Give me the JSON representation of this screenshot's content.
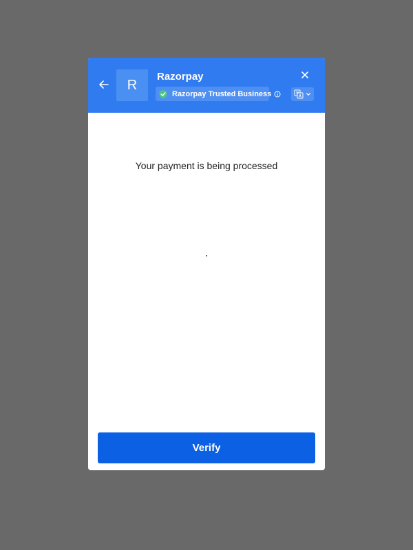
{
  "header": {
    "logo_letter": "R",
    "merchant_name": "Razorpay",
    "trust_badge": "Razorpay Trusted Business",
    "icons": {
      "back": "arrow-left-icon",
      "close": "close-icon",
      "shield": "shield-check-icon",
      "info": "info-icon",
      "language": "translate-icon",
      "dropdown": "chevron-down-icon"
    }
  },
  "main": {
    "status": "Your payment is being processed"
  },
  "footer": {
    "verify_label": "Verify"
  },
  "colors": {
    "overlay": "#696969",
    "header": "#2f7bef",
    "button": "#0b60e3",
    "badge": "#4f8ff1",
    "shield": "#49c780"
  }
}
